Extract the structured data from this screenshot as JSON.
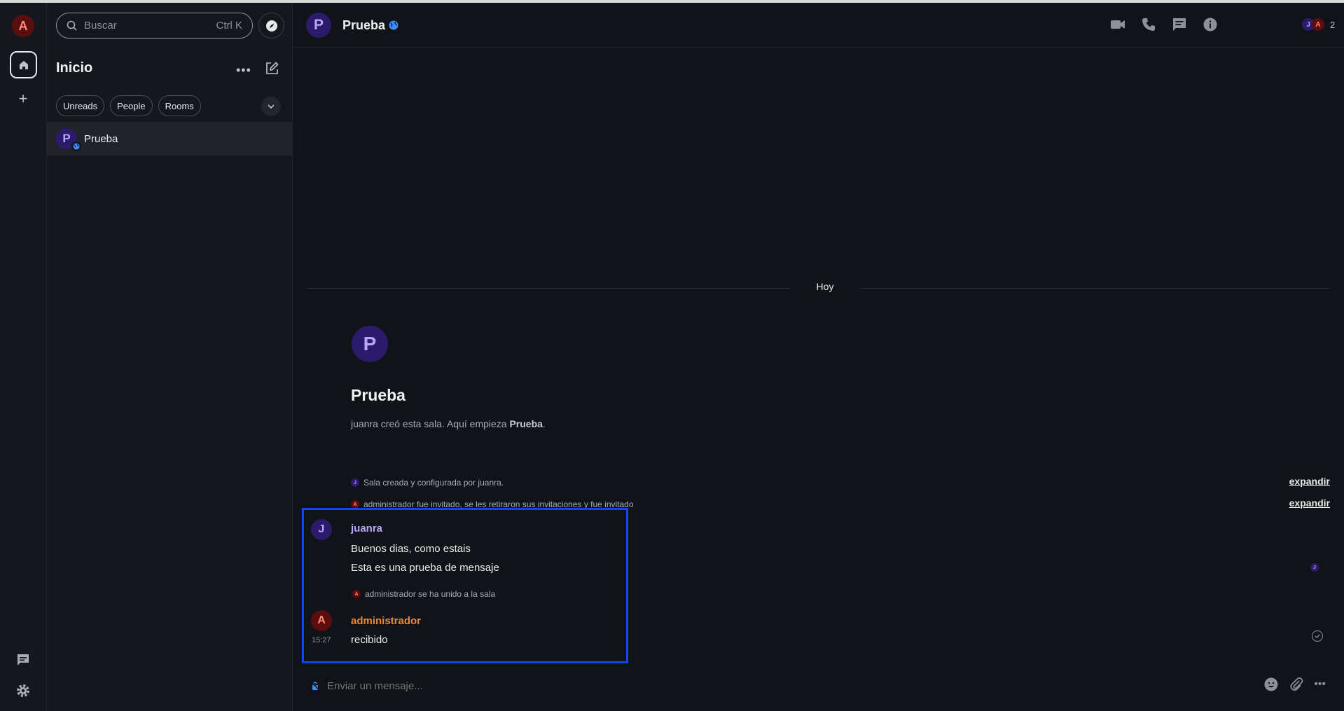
{
  "user": {
    "initial": "A"
  },
  "search": {
    "placeholder": "Buscar",
    "shortcut": "Ctrl K"
  },
  "roomlist": {
    "title": "Inicio",
    "filters": [
      "Unreads",
      "People",
      "Rooms"
    ],
    "rooms": [
      {
        "initial": "P",
        "name": "Prueba"
      }
    ]
  },
  "header": {
    "initial": "P",
    "title": "Prueba",
    "member_initials": [
      "J",
      "A"
    ],
    "member_count": "2"
  },
  "timeline": {
    "date_separator": "Hoy",
    "room_initial": "P",
    "room_title": "Prueba",
    "created_prefix": "juanra creó esta sala. Aquí empieza ",
    "created_room": "Prueba",
    "created_suffix": ".",
    "events": [
      {
        "avatar": "J",
        "text": "Sala creada y configurada por juanra.",
        "action": "expandir"
      },
      {
        "avatar": "A",
        "text": "administrador fue invitado, se les retiraron sus invitaciones y fue invitado",
        "action": "expandir"
      }
    ],
    "messages": [
      {
        "initial": "J",
        "sender": "juanra",
        "sender_color": "#b9a6ff",
        "lines": [
          "Buenos dias, como estais",
          "Esta es una prueba de mensaje"
        ]
      },
      {
        "initial": "A",
        "sender": "administrador",
        "sender_color": "#e8893a",
        "time": "15:27",
        "lines": [
          "recibido"
        ]
      }
    ],
    "join_event": {
      "avatar": "A",
      "text": "administrador se ha unido a la sala"
    },
    "read_receipt": "J"
  },
  "composer": {
    "placeholder": "Enviar un mensaje..."
  },
  "colors": {
    "accent": "#0a47ff",
    "background": "#101318"
  }
}
